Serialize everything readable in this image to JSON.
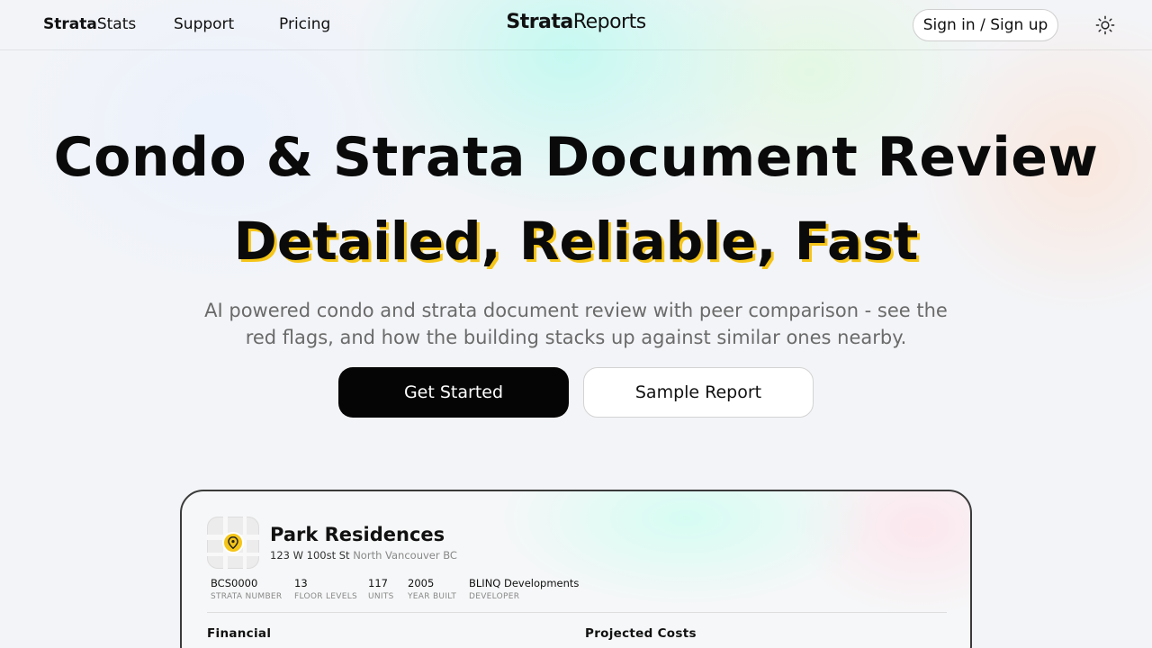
{
  "nav": {
    "brand_bold": "Strata",
    "brand_rest": "Stats",
    "support": "Support",
    "pricing": "Pricing",
    "logo_bold": "Strata",
    "logo_rest": "Reports",
    "signin": "Sign in / Sign up",
    "theme_icon": "sun-icon"
  },
  "hero": {
    "title": "Condo & Strata Document Review",
    "highlight": "Detailed, Reliable, Fast",
    "subtitle": "AI powered condo and strata document review with peer comparison - see the red flags, and how the building stacks up against similar ones nearby.",
    "primary_cta": "Get Started",
    "secondary_cta": "Sample Report"
  },
  "preview": {
    "name": "Park Residences",
    "street": "123 W 100st St",
    "city": "North Vancouver BC",
    "stats": [
      {
        "value": "BCS0000",
        "label": "STRATA NUMBER"
      },
      {
        "value": "13",
        "label": "FLOOR LEVELS"
      },
      {
        "value": "117",
        "label": "UNITS"
      },
      {
        "value": "2005",
        "label": "YEAR BUILT"
      },
      {
        "value": "BLINQ Developments",
        "label": "DEVELOPER"
      }
    ],
    "section_financial": "Financial",
    "section_projected": "Projected Costs"
  },
  "colors": {
    "accent_yellow": "#f5c518",
    "primary_black": "#050505"
  }
}
